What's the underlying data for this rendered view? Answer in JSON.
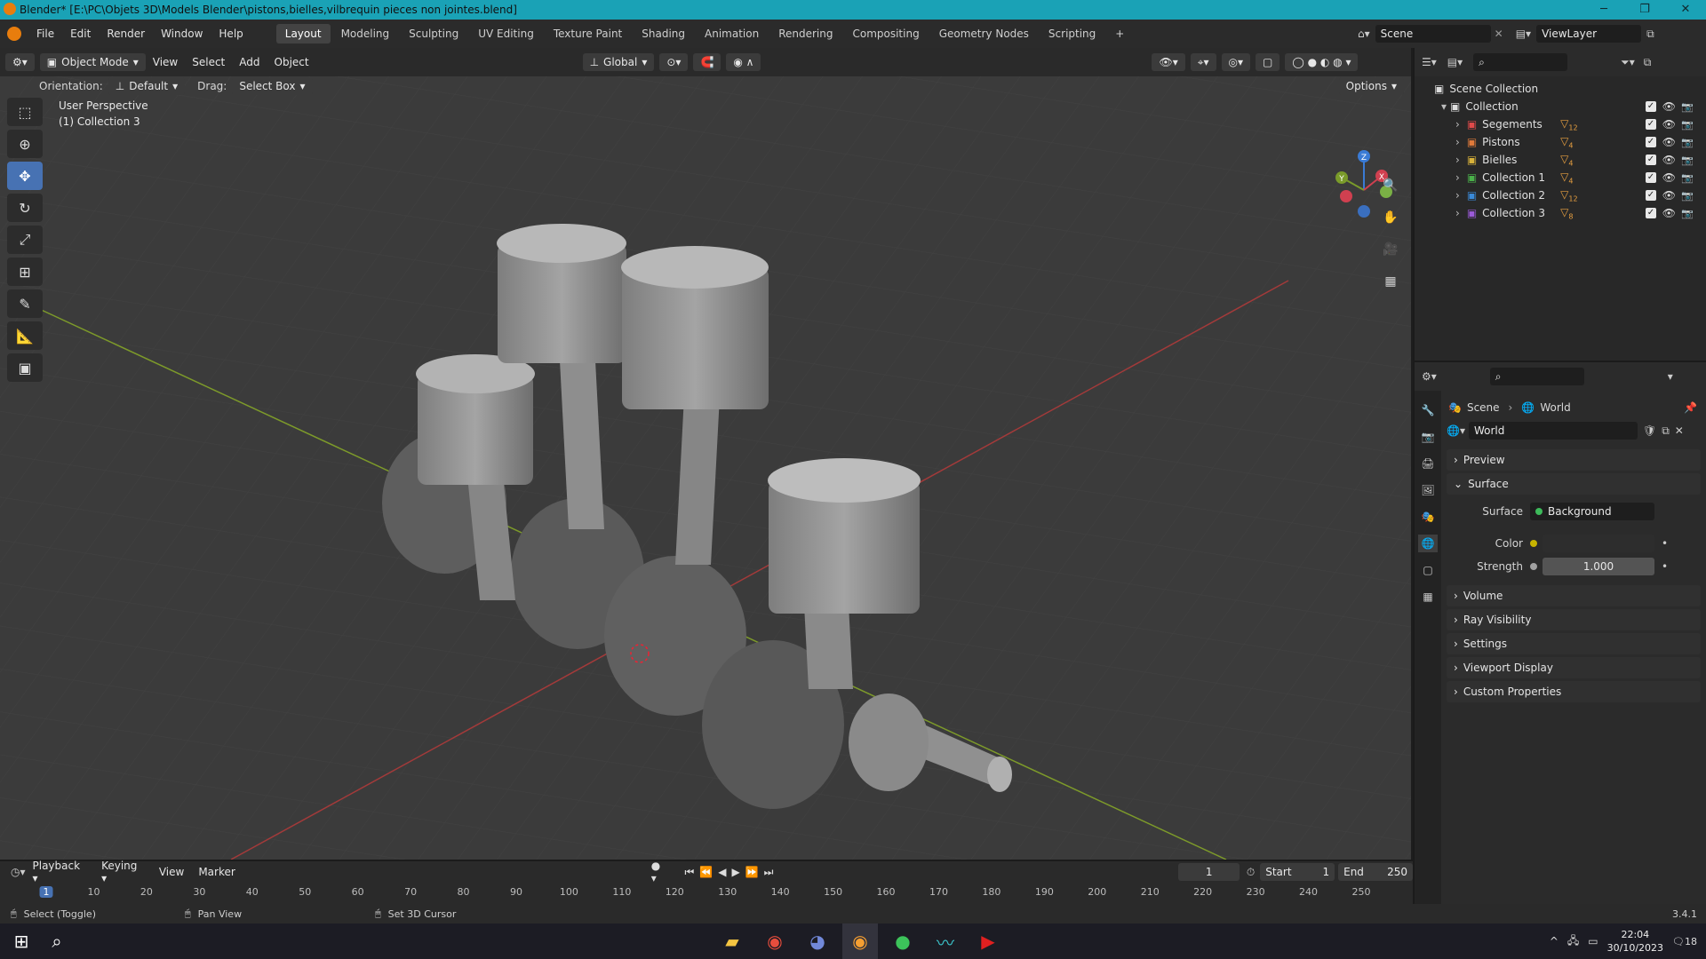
{
  "window": {
    "title": "Blender* [E:\\PC\\Objets 3D\\Models Blender\\pistons,bielles,vilbrequin pieces non jointes.blend]",
    "min": "─",
    "max": "❐",
    "close": "✕"
  },
  "menu": {
    "file": "File",
    "edit": "Edit",
    "render": "Render",
    "window": "Window",
    "help": "Help"
  },
  "workspaces": [
    "Layout",
    "Modeling",
    "Sculpting",
    "UV Editing",
    "Texture Paint",
    "Shading",
    "Animation",
    "Rendering",
    "Compositing",
    "Geometry Nodes",
    "Scripting",
    "+"
  ],
  "scene": {
    "scene": "Scene",
    "view_layer": "ViewLayer"
  },
  "viewport_header": {
    "mode": "Object Mode",
    "view": "View",
    "select": "Select",
    "add": "Add",
    "object": "Object",
    "transform": "Global",
    "orientation_label": "Orientation:",
    "orientation": "Default",
    "drag_label": "Drag:",
    "drag": "Select Box",
    "options": "Options"
  },
  "overlay": {
    "perspective": "User Perspective",
    "collection": "(1) Collection 3"
  },
  "gizmo": {
    "z": "Z",
    "y": "Y",
    "x": "X"
  },
  "outliner": {
    "root": "Scene Collection",
    "collection": "Collection",
    "items": [
      {
        "name": "Segements",
        "count": "12",
        "color": "#e04a4a"
      },
      {
        "name": "Pistons",
        "count": "4",
        "color": "#e07a3a"
      },
      {
        "name": "Bielles",
        "count": "4",
        "color": "#d8b23a"
      },
      {
        "name": "Collection 1",
        "count": "4",
        "color": "#4ab04a"
      },
      {
        "name": "Collection 2",
        "count": "12",
        "color": "#3a8ad8"
      },
      {
        "name": "Collection 3",
        "count": "8",
        "color": "#9a5ad8"
      }
    ]
  },
  "properties": {
    "breadcrumb_scene": "Scene",
    "breadcrumb_world": "World",
    "world_name": "World",
    "panels": {
      "preview": "Preview",
      "surface": "Surface",
      "volume": "Volume",
      "ray_visibility": "Ray Visibility",
      "settings": "Settings",
      "viewport_display": "Viewport Display",
      "custom_properties": "Custom Properties"
    },
    "surface_label": "Surface",
    "surface_value": "Background",
    "color_label": "Color",
    "strength_label": "Strength",
    "strength_value": "1.000"
  },
  "timeline": {
    "playback": "Playback",
    "keying": "Keying",
    "view": "View",
    "marker": "Marker",
    "current_frame": "1",
    "start_label": "Start",
    "start": "1",
    "end_label": "End",
    "end": "250",
    "ticks": [
      "1",
      "10",
      "20",
      "30",
      "40",
      "50",
      "60",
      "70",
      "80",
      "90",
      "100",
      "110",
      "120",
      "130",
      "140",
      "150",
      "160",
      "170",
      "180",
      "190",
      "200",
      "210",
      "220",
      "230",
      "240",
      "250"
    ]
  },
  "status": {
    "select": "Select (Toggle)",
    "pan": "Pan View",
    "cursor": "Set 3D Cursor",
    "version": "3.4.1"
  },
  "taskbar": {
    "time": "22:04",
    "date": "30/10/2023",
    "notif": "18"
  }
}
